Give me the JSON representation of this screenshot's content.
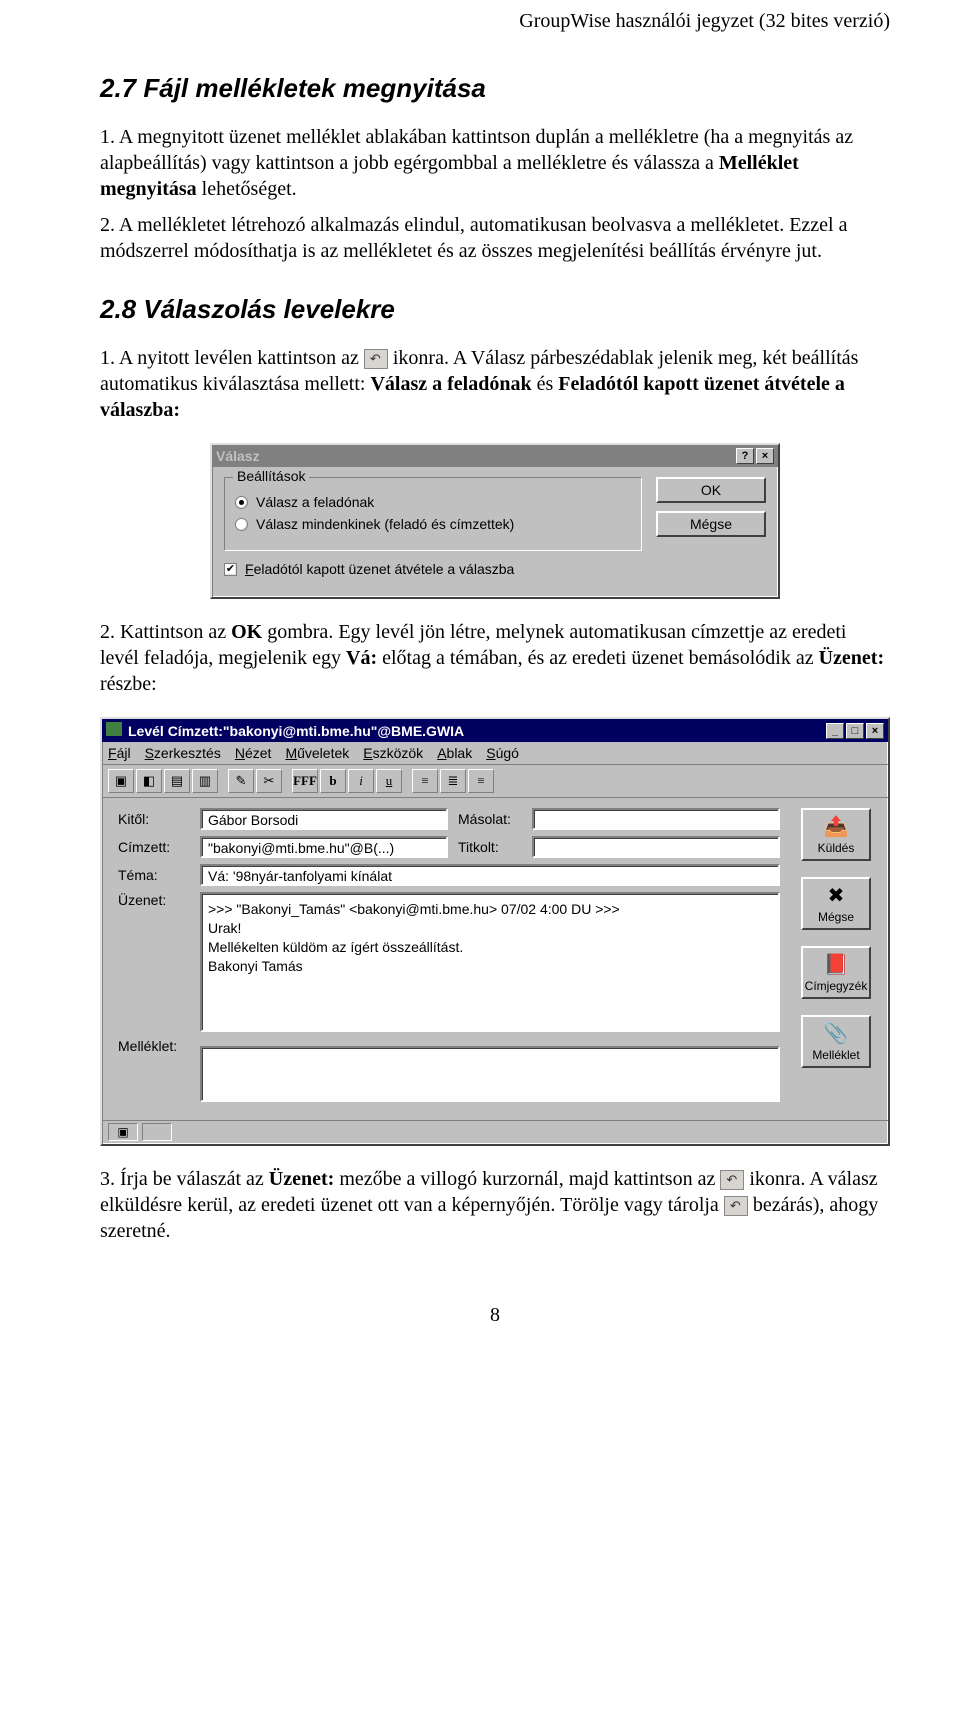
{
  "header_note": "GroupWise használói jegyzet (32 bites verzió)",
  "section27": {
    "heading": "2.7 Fájl mellékletek megnyitása",
    "para1_pre": "1. A megnyitott üzenet melléklet ablakában kattintson duplán a mellékletre (ha a megnyitás az alapbeállítás) vagy kattintson a jobb egérgombbal a mellékletre és válassza a ",
    "para1_bold": "Melléklet megnyitása",
    "para1_post": " lehetőséget.",
    "para2": "2. A mellékletet létrehozó alkalmazás elindul, automatikusan beolvasva a mellékletet. Ezzel a módszerrel módosíthatja is az mellékletet és az összes megjelenítési beállítás érvényre jut."
  },
  "section28": {
    "heading": "2.8 Válaszolás levelekre",
    "para1_pre": "1. A nyitott levélen kattintson az",
    "para1_post": " ikonra. A Válasz párbeszédablak jelenik meg, két beállítás automatikus kiválasztása mellett: ",
    "para1_bold1": "Válasz a feladónak",
    "para1_mid": " és ",
    "para1_bold2": "Feladótól kapott üzenet átvétele a válaszba:"
  },
  "reply_dialog": {
    "title": "Válasz",
    "group_label": "Beállítások",
    "radio1": "Válasz a feladónak",
    "radio2": "Válasz mindenkinek (feladó és címzettek)",
    "checkbox": "Feladótól kapott üzenet átvétele a válaszba",
    "ok": "OK",
    "cancel": "Mégse"
  },
  "para_ok_pre": "2. Kattintson az ",
  "para_ok_bold1": "OK",
  "para_ok_mid1": " gombra. Egy levél jön létre, melynek automatikusan címzettje az eredeti levél feladója, megjelenik egy ",
  "para_ok_bold2": "Vá:",
  "para_ok_mid2": " előtag a témában, és az eredeti üzenet bemásolódik az ",
  "para_ok_bold3": "Üzenet:",
  "para_ok_post": " részbe:",
  "mail": {
    "title": "Levél Címzett:\"bakonyi@mti.bme.hu\"@BME.GWIA",
    "menu": {
      "f": "Fájl",
      "e": "Szerkesztés",
      "n": "Nézet",
      "m": "Műveletek",
      "esz": "Eszközök",
      "a": "Ablak",
      "s": "Súgó"
    },
    "labels": {
      "from": "Kitől:",
      "to": "Címzett:",
      "cc": "Másolat:",
      "bcc": "Titkolt:",
      "subject": "Téma:",
      "body": "Üzenet:",
      "attach": "Melléklet:"
    },
    "fields": {
      "from": "Gábor Borsodi",
      "to": "\"bakonyi@mti.bme.hu\"@B(...)",
      "cc": "",
      "bcc": "",
      "subject": "Vá: '98nyár-tanfolyami kínálat",
      "body": ">>> \"Bakonyi_Tamás\" <bakonyi@mti.bme.hu> 07/02 4:00 DU >>>\nUrak!\nMellékelten küldöm az ígért összeállítást.\nBakonyi Tamás"
    },
    "side": {
      "send": "Küldés",
      "cancel": "Mégse",
      "addr": "Címjegyzék",
      "attach": "Melléklet"
    }
  },
  "para3_pre": "3. Írja be válaszát az ",
  "para3_bold1": "Üzenet:",
  "para3_mid1": " mezőbe a villogó kurzornál, majd kattintson az",
  "para3_mid2": " ikonra. A válasz elküldésre kerül, az eredeti üzenet ott van a képernyőjén. Törölje vagy tárolja",
  "para3_post": "bezárás), ahogy szeretné.",
  "page_num": "8"
}
